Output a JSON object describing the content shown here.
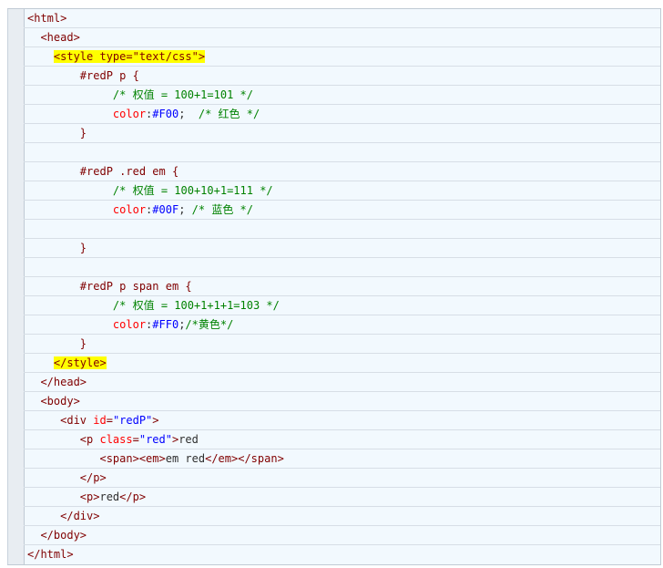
{
  "code_lines": [
    {
      "indent": 0,
      "parts": [
        {
          "cls": "t",
          "text": "<html>"
        }
      ]
    },
    {
      "indent": 2,
      "parts": [
        {
          "cls": "t",
          "text": "<head>"
        }
      ]
    },
    {
      "indent": 4,
      "parts": [
        {
          "cls": "hl",
          "text": "<style type=\"text/css\">"
        }
      ]
    },
    {
      "indent": 8,
      "parts": [
        {
          "cls": "s",
          "text": "#redP p {"
        }
      ]
    },
    {
      "indent": 13,
      "parts": [
        {
          "cls": "c",
          "text": "/* 权值 = 100+1=101 */"
        }
      ]
    },
    {
      "indent": 13,
      "parts": [
        {
          "cls": "p",
          "text": "color"
        },
        {
          "cls": "k",
          "text": ":"
        },
        {
          "cls": "val",
          "text": "#F00"
        },
        {
          "cls": "k",
          "text": ";  "
        },
        {
          "cls": "c",
          "text": "/* 红色 */"
        }
      ]
    },
    {
      "indent": 8,
      "parts": [
        {
          "cls": "s",
          "text": "}"
        }
      ]
    },
    {
      "indent": 0,
      "parts": []
    },
    {
      "indent": 8,
      "parts": [
        {
          "cls": "s",
          "text": "#redP .red em {"
        }
      ]
    },
    {
      "indent": 13,
      "parts": [
        {
          "cls": "c",
          "text": "/* 权值 = 100+10+1=111 */"
        }
      ]
    },
    {
      "indent": 13,
      "parts": [
        {
          "cls": "p",
          "text": "color"
        },
        {
          "cls": "k",
          "text": ":"
        },
        {
          "cls": "val",
          "text": "#00F"
        },
        {
          "cls": "k",
          "text": "; "
        },
        {
          "cls": "c",
          "text": "/* 蓝色 */"
        }
      ]
    },
    {
      "indent": 0,
      "parts": []
    },
    {
      "indent": 8,
      "parts": [
        {
          "cls": "s",
          "text": "}"
        }
      ]
    },
    {
      "indent": 0,
      "parts": []
    },
    {
      "indent": 8,
      "parts": [
        {
          "cls": "s",
          "text": "#redP p span em {"
        }
      ]
    },
    {
      "indent": 13,
      "parts": [
        {
          "cls": "c",
          "text": "/* 权值 = 100+1+1+1=103 */"
        }
      ]
    },
    {
      "indent": 13,
      "parts": [
        {
          "cls": "p",
          "text": "color"
        },
        {
          "cls": "k",
          "text": ":"
        },
        {
          "cls": "val",
          "text": "#FF0"
        },
        {
          "cls": "k",
          "text": ";"
        },
        {
          "cls": "c",
          "text": "/*黄色*/"
        }
      ]
    },
    {
      "indent": 8,
      "parts": [
        {
          "cls": "s",
          "text": "}"
        }
      ]
    },
    {
      "indent": 4,
      "parts": [
        {
          "cls": "hl",
          "text": "</style>"
        }
      ]
    },
    {
      "indent": 2,
      "parts": [
        {
          "cls": "t",
          "text": "</head>"
        }
      ]
    },
    {
      "indent": 2,
      "parts": [
        {
          "cls": "t",
          "text": "<body>"
        }
      ]
    },
    {
      "indent": 5,
      "parts": [
        {
          "cls": "t",
          "text": "<div "
        },
        {
          "cls": "a",
          "text": "id"
        },
        {
          "cls": "t",
          "text": "="
        },
        {
          "cls": "v",
          "text": "\"redP\""
        },
        {
          "cls": "t",
          "text": ">"
        }
      ]
    },
    {
      "indent": 8,
      "parts": [
        {
          "cls": "t",
          "text": "<p "
        },
        {
          "cls": "a",
          "text": "class"
        },
        {
          "cls": "t",
          "text": "="
        },
        {
          "cls": "v",
          "text": "\"red\""
        },
        {
          "cls": "t",
          "text": ">"
        },
        {
          "cls": "k",
          "text": "red"
        }
      ]
    },
    {
      "indent": 11,
      "parts": [
        {
          "cls": "t",
          "text": "<span><em>"
        },
        {
          "cls": "k",
          "text": "em red"
        },
        {
          "cls": "t",
          "text": "</em></span>"
        }
      ]
    },
    {
      "indent": 8,
      "parts": [
        {
          "cls": "t",
          "text": "</p>"
        }
      ]
    },
    {
      "indent": 8,
      "parts": [
        {
          "cls": "t",
          "text": "<p>"
        },
        {
          "cls": "k",
          "text": "red"
        },
        {
          "cls": "t",
          "text": "</p>"
        }
      ]
    },
    {
      "indent": 5,
      "parts": [
        {
          "cls": "t",
          "text": "</div>"
        }
      ]
    },
    {
      "indent": 2,
      "parts": [
        {
          "cls": "t",
          "text": "</body>"
        }
      ]
    },
    {
      "indent": 0,
      "parts": [
        {
          "cls": "t",
          "text": "</html>"
        }
      ]
    }
  ]
}
